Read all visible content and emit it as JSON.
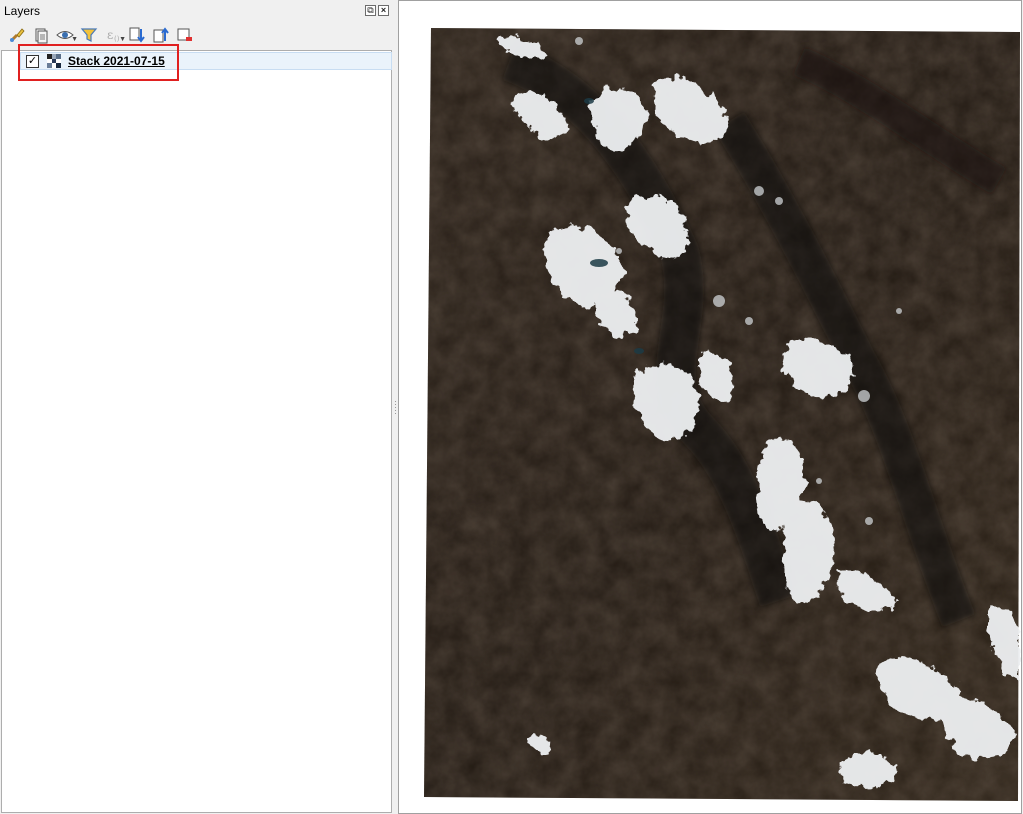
{
  "layers_panel": {
    "title": "Layers",
    "float_icon": "float-icon",
    "close_icon": "close-icon",
    "toolbar": [
      {
        "name": "style-manager-icon",
        "tooltip": "Open Layer Styling Panel"
      },
      {
        "name": "add-group-icon",
        "tooltip": "Add Group"
      },
      {
        "name": "visibility-eye-icon",
        "tooltip": "Manage Map Themes"
      },
      {
        "name": "filter-icon",
        "tooltip": "Filter Legend"
      },
      {
        "name": "filter-expression-icon",
        "tooltip": "Filter by Expression"
      },
      {
        "name": "expand-all-icon",
        "tooltip": "Expand All"
      },
      {
        "name": "collapse-all-icon",
        "tooltip": "Collapse All"
      },
      {
        "name": "remove-layer-icon",
        "tooltip": "Remove Layer"
      }
    ],
    "layers": [
      {
        "name": "Stack 2021-07-15",
        "checked": true,
        "type_icon": "raster-icon"
      }
    ]
  },
  "map_canvas": {
    "content": "satellite-raster-image",
    "colors": {
      "background": "#ffffff",
      "terrain": "#2b2119",
      "snow": "#eef0f2"
    }
  },
  "annotation": {
    "highlight_color": "#e02020"
  }
}
